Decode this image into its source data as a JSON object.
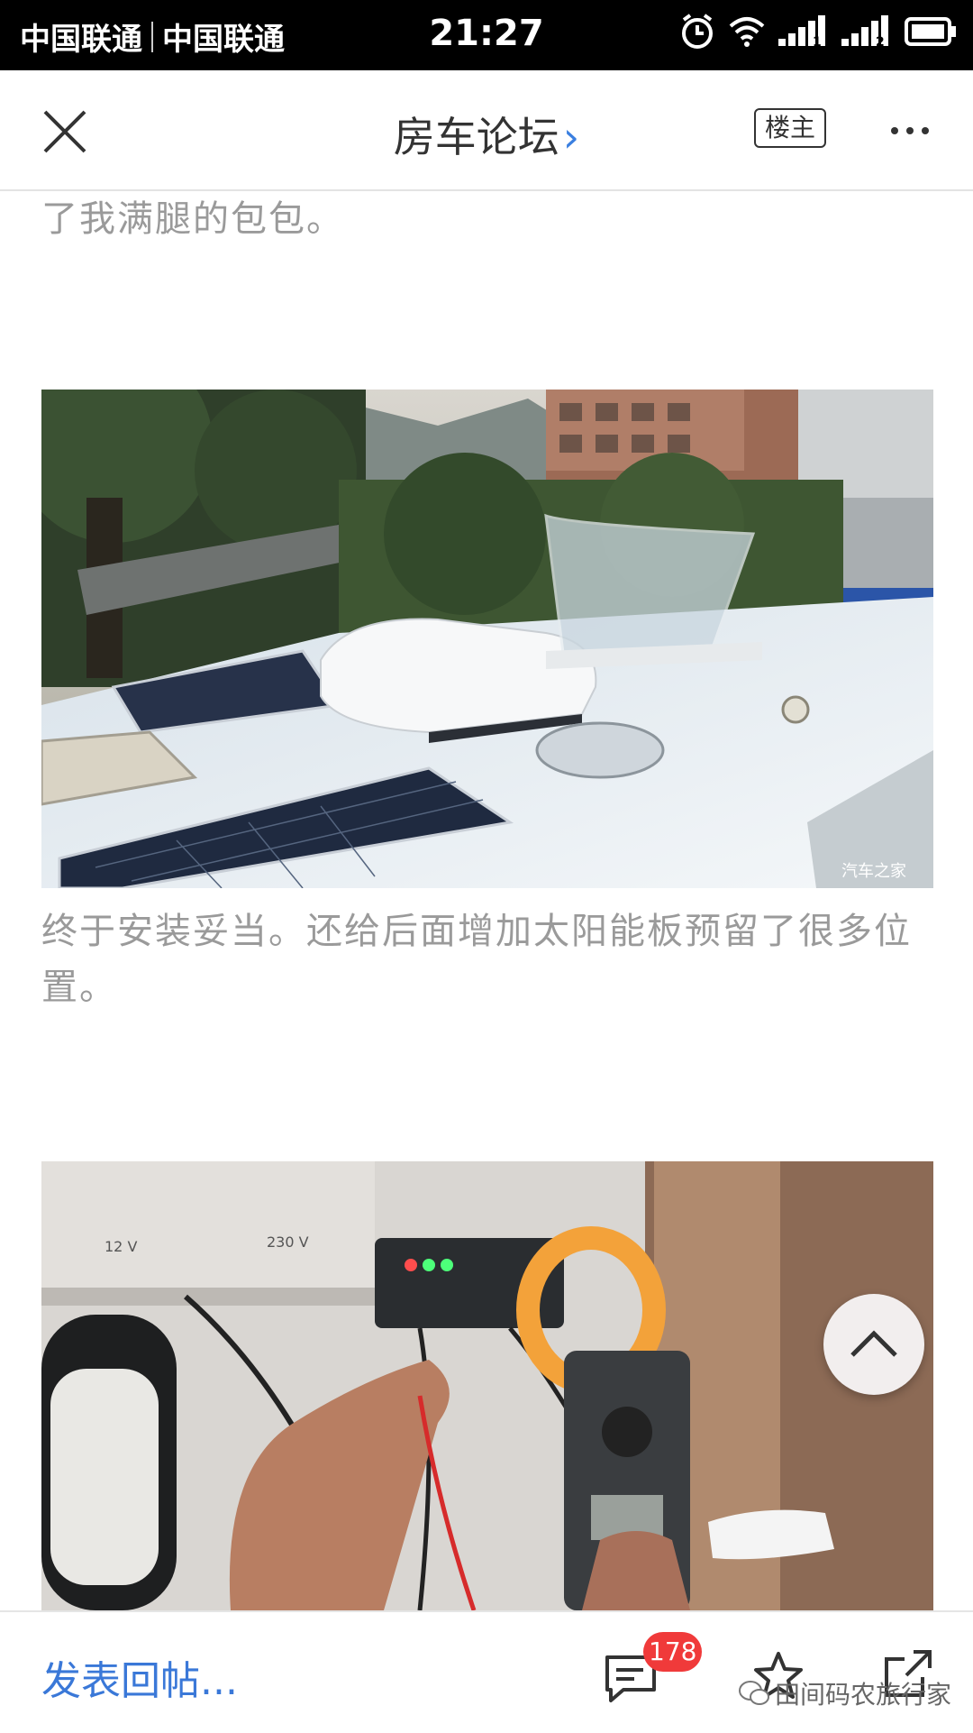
{
  "status_bar": {
    "carrier_1": "中国联通",
    "carrier_2": "中国联通",
    "time": "21:27",
    "signal_1_label": "1",
    "signal_2_label": "2"
  },
  "nav": {
    "title": "房车论坛",
    "title_chevron": "›",
    "op_badge": "楼主",
    "close_icon": "close-icon",
    "more_icon": "more-icon"
  },
  "post": {
    "para_1": "了我满腿的包包。",
    "image_1_watermark": "汽车之家",
    "para_2": "终于安装妥当。还给后面增加太阳能板预留了很多位置。",
    "image_1_subject": "rv-roof-solar-panels-photo",
    "image_2_subject": "solar-controller-multimeter-photo",
    "image_2_labels": [
      "12 V",
      "230 V"
    ]
  },
  "bottom_bar": {
    "reply_placeholder": "发表回帖...",
    "comment_count": "178",
    "watermark": "田间码农旅行家"
  },
  "colors": {
    "accent_blue": "#3a78d8",
    "badge_red": "#f03a3a",
    "body_text": "#9a9a9a"
  }
}
